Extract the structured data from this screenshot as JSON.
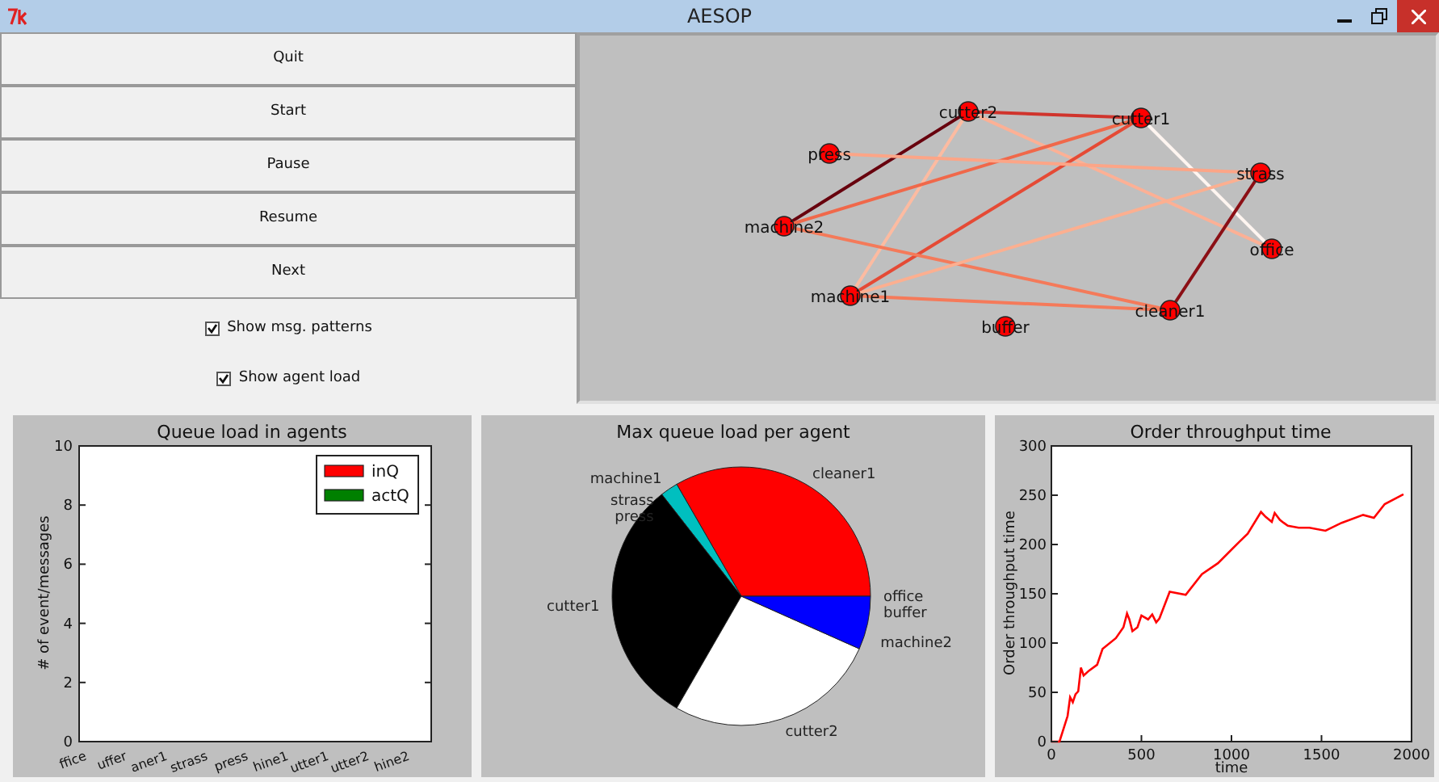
{
  "window": {
    "title": "AESOP"
  },
  "buttons": [
    "Quit",
    "Start",
    "Pause",
    "Resume",
    "Next"
  ],
  "checkboxes": [
    {
      "label": "Show msg. patterns",
      "checked": true
    },
    {
      "label": "Show agent load",
      "checked": true
    }
  ],
  "graph": {
    "nodes": [
      {
        "name": "cutter2"
      },
      {
        "name": "cutter1"
      },
      {
        "name": "press"
      },
      {
        "name": "strass"
      },
      {
        "name": "machine2"
      },
      {
        "name": "office"
      },
      {
        "name": "machine1"
      },
      {
        "name": "cleaner1"
      },
      {
        "name": "buffer"
      }
    ],
    "edges": [
      {
        "color": "#d0342c"
      },
      {
        "color": "#67000d"
      },
      {
        "color": "#fcbba1"
      },
      {
        "color": "#fcb095"
      },
      {
        "color": "#f0684a"
      },
      {
        "color": "#e54a35"
      },
      {
        "color": "#fff5f0"
      },
      {
        "color": "#fca587"
      },
      {
        "color": "#f47a5a"
      },
      {
        "color": "#fcaf90"
      },
      {
        "color": "#f57a5a"
      },
      {
        "color": "#8b0f15"
      }
    ]
  },
  "charts": [
    {
      "chart_data": {
        "type": "bar",
        "title": "Queue load in agents",
        "ylabel": "# of event/messages",
        "categories": [
          "ffice",
          "uffer",
          "aner1",
          "strass",
          "press",
          "hine1",
          "utter1",
          "utter2",
          "hine2"
        ],
        "ylim": [
          0,
          10
        ],
        "yticks": [
          0,
          2,
          4,
          6,
          8,
          10
        ],
        "series": [
          {
            "name": "inQ",
            "color": "#ff0000",
            "values": [
              0,
              0,
              0,
              0,
              0,
              0,
              0,
              0,
              0
            ]
          },
          {
            "name": "actQ",
            "color": "#008000",
            "values": [
              0,
              0,
              0,
              0,
              0,
              0,
              0,
              0,
              0
            ]
          }
        ]
      }
    },
    {
      "chart_data": {
        "type": "pie",
        "title": "Max queue load per agent",
        "categories": [
          "office",
          "buffer",
          "cleaner1",
          "machine1",
          "strass",
          "press",
          "cutter1",
          "cutter2",
          "machine2"
        ],
        "values": [
          0,
          0,
          15,
          1,
          0,
          0,
          14,
          12,
          3
        ],
        "colors": [
          null,
          null,
          "#ff0000",
          "#00bfbf",
          null,
          null,
          "#000000",
          "#ffffff",
          "#0000ff"
        ]
      }
    },
    {
      "chart_data": {
        "type": "line",
        "title": "Order throughput time",
        "xlabel": "time",
        "ylabel": "Order throughput time",
        "xlim": [
          0,
          2000
        ],
        "ylim": [
          0,
          300
        ],
        "xticks": [
          0,
          500,
          1000,
          1500,
          2000
        ],
        "yticks": [
          0,
          50,
          100,
          150,
          200,
          250,
          300
        ],
        "x": [
          0,
          45,
          90,
          104,
          119,
          134,
          149,
          164,
          179,
          209,
          254,
          284,
          358,
          400,
          420,
          433,
          450,
          478,
          500,
          537,
          560,
          582,
          600,
          657,
          746,
          836,
          925,
          1045,
          1090,
          1164,
          1190,
          1224,
          1240,
          1269,
          1290,
          1313,
          1373,
          1433,
          1522,
          1612,
          1731,
          1791,
          1851,
          1955
        ],
        "series": [
          {
            "color": "#ff0000",
            "values": [
              0,
              0,
              26,
              45,
              40,
              48,
              51,
              75,
              67,
              72,
              78,
              94,
              105,
              116,
              130,
              124,
              112,
              116,
              128,
              124,
              129,
              121,
              125,
              152,
              149,
              170,
              181,
              203,
              211,
              233,
              228,
              223,
              232,
              225,
              222,
              219,
              217,
              217,
              214,
              222,
              230,
              227,
              241,
              251
            ]
          }
        ]
      }
    }
  ]
}
